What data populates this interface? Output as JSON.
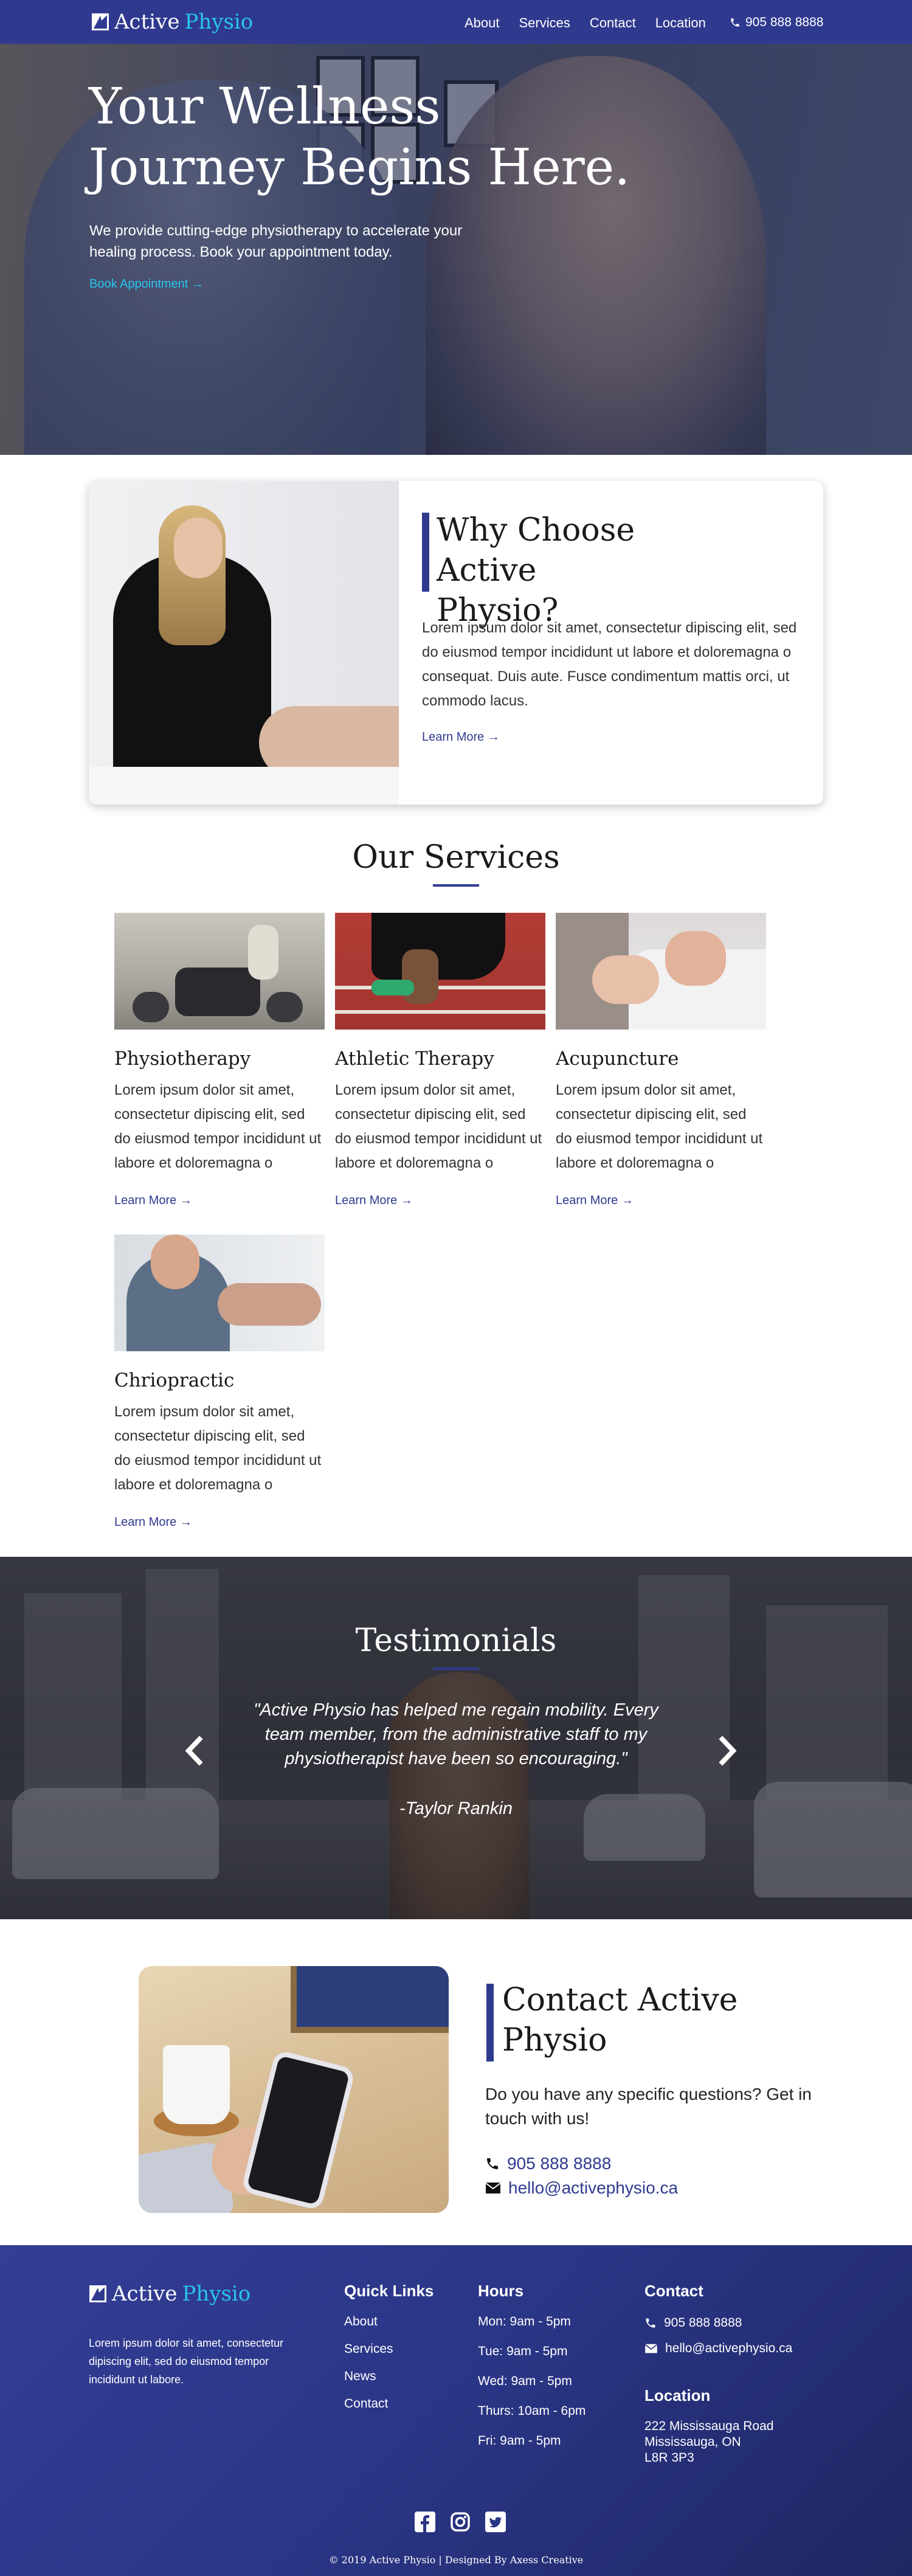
{
  "brand": {
    "name_a": "Active",
    "name_b": "Physio",
    "accent": "#29c4ef",
    "primary": "#2f3a8f"
  },
  "nav": {
    "links": [
      "About",
      "Services",
      "Contact",
      "Location"
    ],
    "phone": "905 888 8888"
  },
  "hero": {
    "title": "Your Wellness Journey Begins Here.",
    "text": "We provide cutting-edge physiotherapy to accelerate your healing process. Book your appointment today.",
    "cta": "Book Appointment →"
  },
  "why": {
    "title": "Why Choose Active Physio?",
    "text": "Lorem ipsum dolor sit amet, consectetur dipiscing elit, sed do eiusmod tempor incididunt ut labore et doloremagna o consequat. Duis aute. Fusce condimentum mattis orci, ut commodo lacus.",
    "link": "Learn More →"
  },
  "services": {
    "title": "Our Services",
    "items": [
      {
        "name": "Physiotherapy",
        "desc": "Lorem ipsum dolor sit amet, consectetur dipiscing elit, sed do eiusmod tempor incididunt ut labore et doloremagna o",
        "link": "Learn More →"
      },
      {
        "name": "Athletic Therapy",
        "desc": "Lorem ipsum dolor sit amet, consectetur dipiscing elit, sed do eiusmod tempor incididunt ut labore et doloremagna o",
        "link": "Learn More →"
      },
      {
        "name": "Acupuncture",
        "desc": "Lorem ipsum dolor sit amet, consectetur dipiscing elit, sed do eiusmod tempor incididunt ut labore et doloremagna o",
        "link": "Learn More →"
      },
      {
        "name": "Chriopractic",
        "desc": "Lorem ipsum dolor sit amet, consectetur dipiscing elit, sed do eiusmod tempor incididunt ut labore et doloremagna o",
        "link": "Learn More →"
      }
    ]
  },
  "testimonials": {
    "title": "Testimonials",
    "quote": "\"Active Physio has helped me regain mobility. Every team member, from the administrative staff to my physiotherapist have  been so encouraging.\"",
    "author": "-Taylor Rankin"
  },
  "contact": {
    "title": "Contact Active Physio",
    "text": "Do you have any specific questions? Get in touch with us!",
    "phone": "905 888 8888",
    "email": "hello@activephysio.ca"
  },
  "footer": {
    "about": "Lorem ipsum dolor sit amet, consectetur dipiscing elit, sed do eiusmod tempor incididunt ut labore.",
    "quick_links_title": "Quick Links",
    "quick_links": [
      "About",
      "Services",
      "News",
      "Contact"
    ],
    "hours_title": "Hours",
    "hours": [
      "Mon: 9am - 5pm",
      "Tue: 9am - 5pm",
      "Wed: 9am - 5pm",
      "Thurs: 10am - 6pm",
      "Fri: 9am - 5pm"
    ],
    "contact_title": "Contact",
    "phone": "905 888 8888",
    "email": "hello@activephysio.ca",
    "location_title": "Location",
    "address": [
      "222 Mississauga Road",
      "Mississauga, ON",
      "L8R 3P3"
    ],
    "socials": [
      "facebook-icon",
      "instagram-icon",
      "twitter-icon"
    ],
    "copyright": "© 2019 Active Physio | Designed By Axess Creative"
  }
}
